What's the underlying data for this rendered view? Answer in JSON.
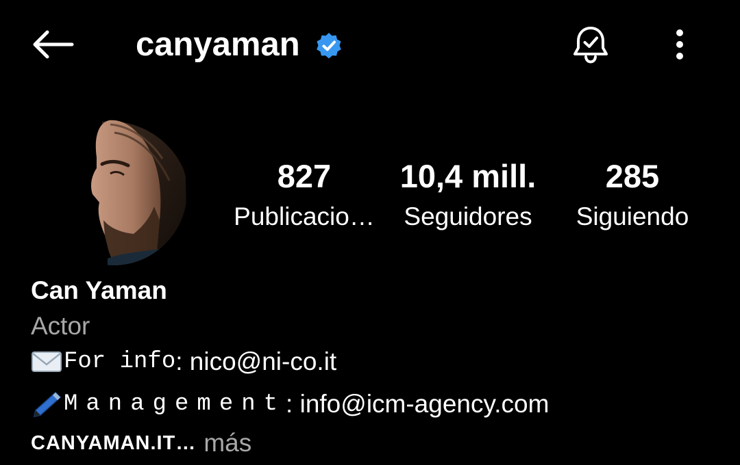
{
  "header": {
    "username": "canyaman",
    "verified": true
  },
  "profile": {
    "stats": [
      {
        "value": "827",
        "label": "Publicacio…"
      },
      {
        "value": "10,4 mill.",
        "label": "Seguidores"
      },
      {
        "value": "285",
        "label": "Siguiendo"
      }
    ],
    "full_name": "Can Yaman",
    "category": "Actor",
    "bio": {
      "line1_prefix": "For info",
      "line1_value": ": nico@ni-co.it",
      "line2_prefix": "Management",
      "line2_value": ": info@icm-agency.com"
    },
    "link_text": "CANYAMAN.IT",
    "ellipsis": "…",
    "more_label": "más"
  },
  "icons": {
    "back": "back-arrow-icon",
    "verified": "verified-badge-icon",
    "bell": "notification-bell-check-icon",
    "more": "more-vertical-icon",
    "envelope": "envelope-emoji",
    "pen": "pen-emoji"
  },
  "colors": {
    "background": "#000000",
    "text": "#ffffff",
    "secondary_text": "#a8a8a8",
    "verified_blue": "#3897f0"
  }
}
